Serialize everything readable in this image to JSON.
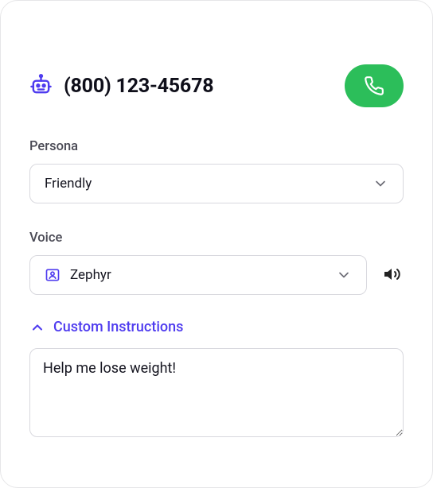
{
  "header": {
    "title": "(800) 123-45678"
  },
  "fields": {
    "persona_label": "Persona",
    "persona_value": "Friendly",
    "voice_label": "Voice",
    "voice_value": "Zephyr"
  },
  "custom_instructions": {
    "toggle_label": "Custom Instructions",
    "value": "Help me lose weight!"
  }
}
